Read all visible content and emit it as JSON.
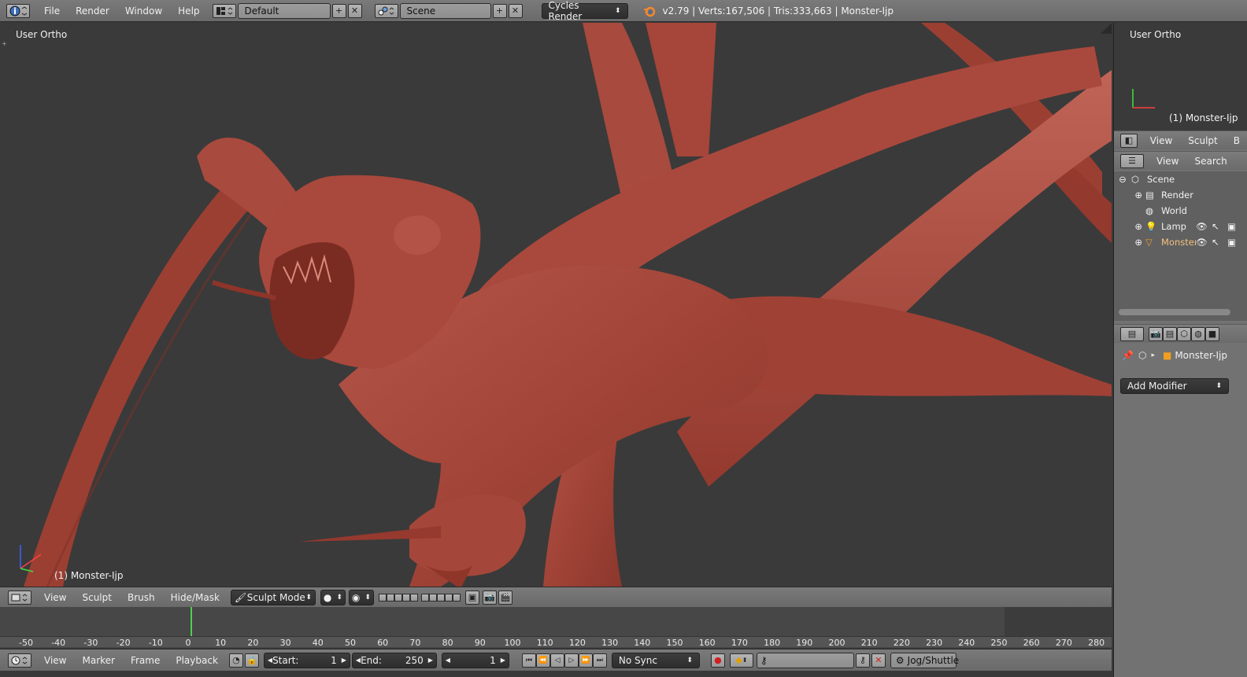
{
  "topbar": {
    "menus": [
      "File",
      "Render",
      "Window",
      "Help"
    ],
    "screen_layout": "Default",
    "scene": "Scene",
    "render_engine": "Cycles Render",
    "stats": "v2.79 | Verts:167,506 | Tris:333,663 | Monster-Ijp"
  },
  "viewport": {
    "view_name": "User Ortho",
    "object_label": "(1) Monster-Ijp",
    "menus": [
      "View",
      "Sculpt",
      "Brush",
      "Hide/Mask"
    ],
    "mode": "Sculpt Mode"
  },
  "mini_viewport": {
    "view_name": "User Ortho",
    "object_label": "(1) Monster-Ijp",
    "menus": [
      "View",
      "Sculpt",
      "B"
    ]
  },
  "outliner": {
    "menus": [
      "View",
      "Search"
    ],
    "items": [
      {
        "label": "Scene",
        "icon": "scene-icon"
      },
      {
        "label": "Render",
        "icon": "render-layers-icon"
      },
      {
        "label": "World",
        "icon": "world-icon"
      },
      {
        "label": "Lamp",
        "icon": "lamp-icon"
      },
      {
        "label": "Monster",
        "icon": "mesh-icon"
      }
    ]
  },
  "properties": {
    "object_name": "Monster-Ijp",
    "add_modifier": "Add Modifier"
  },
  "timeline": {
    "ticks": [
      "-50",
      "-40",
      "-30",
      "-20",
      "-10",
      "0",
      "10",
      "20",
      "30",
      "40",
      "50",
      "60",
      "70",
      "80",
      "90",
      "100",
      "110",
      "120",
      "130",
      "140",
      "150",
      "160",
      "170",
      "180",
      "190",
      "200",
      "210",
      "220",
      "230",
      "240",
      "250",
      "260",
      "270",
      "280"
    ],
    "current_frame_marker": 0
  },
  "timeline_bar": {
    "menus": [
      "View",
      "Marker",
      "Frame",
      "Playback"
    ],
    "start_label": "Start:",
    "start_value": "1",
    "end_label": "End:",
    "end_value": "250",
    "current_frame": "1",
    "sync": "No Sync",
    "keying": "Jog/Shuttle"
  },
  "colors": {
    "header": "#727272",
    "viewport_bg": "#3a3a3a",
    "sculpt_clay": "#a8473c",
    "playhead": "#4fd04f"
  }
}
